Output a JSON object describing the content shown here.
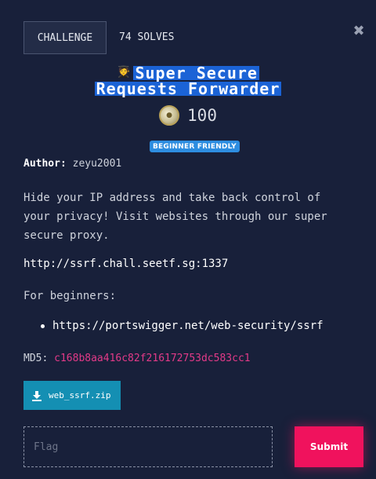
{
  "header": {
    "tab_label": "CHALLENGE",
    "solves": "74 SOLVES",
    "close_glyph": "✖"
  },
  "challenge": {
    "emoji": "🧑‍🎓",
    "title_line1": "Super Secure",
    "title_line2": "Requests Forwarder",
    "points": "100",
    "badge": "BEGINNER FRIENDLY",
    "author_label": "Author:",
    "author": "zeyu2001",
    "description": "Hide your IP address and take back control of your privacy! Visit websites through our super secure proxy.",
    "url": "http://ssrf.chall.seetf.sg:1337",
    "beginners_label": "For beginners:",
    "links": [
      "https://portswigger.net/web-security/ssrf"
    ],
    "md5_label": "MD5:",
    "md5": "c168b8aa416c82f216172753dc583cc1",
    "file_name": "web_ssrf.zip"
  },
  "form": {
    "flag_placeholder": "Flag",
    "submit_label": "Submit"
  },
  "colors": {
    "background": "#18203a",
    "title_highlight": "#1b63d6",
    "badge": "#2d8de0",
    "hash": "#e33a88",
    "download": "#148fb3",
    "submit": "#f0125d"
  },
  "icons": [
    "close-icon",
    "coin-icon",
    "download-icon",
    "student-emoji-icon"
  ]
}
